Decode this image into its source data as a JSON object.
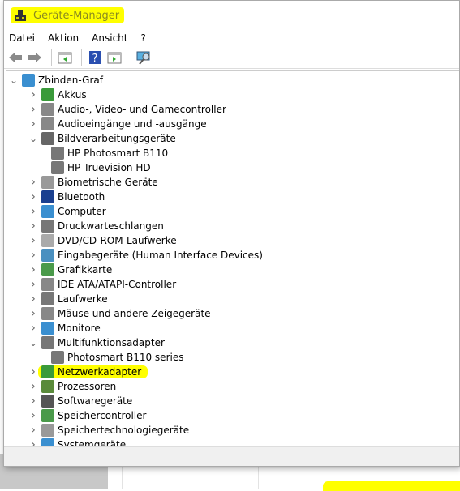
{
  "window": {
    "title": "Geräte-Manager"
  },
  "menu": [
    "Datei",
    "Aktion",
    "Ansicht",
    "?"
  ],
  "toolbar": [
    "back-icon",
    "forward-icon",
    "properties-icon",
    "help-icon",
    "update-icon",
    "scan-hardware-icon"
  ],
  "tree": [
    {
      "label": "Zbinden-Graf",
      "level": 0,
      "state": "expanded",
      "icon": "computer-icon"
    },
    {
      "label": "Akkus",
      "level": 1,
      "state": "collapsed",
      "icon": "battery-icon",
      "color": "#3a9a3a"
    },
    {
      "label": "Audio-, Video- und Gamecontroller",
      "level": 1,
      "state": "collapsed",
      "icon": "speaker-icon",
      "color": "#888888"
    },
    {
      "label": "Audioeingänge und -ausgänge",
      "level": 1,
      "state": "collapsed",
      "icon": "speaker-icon",
      "color": "#888888"
    },
    {
      "label": "Bildverarbeitungsgeräte",
      "level": 1,
      "state": "expanded",
      "icon": "camera-icon",
      "color": "#666666"
    },
    {
      "label": "HP Photosmart B110",
      "level": 2,
      "icon": "scanner-icon",
      "color": "#777777"
    },
    {
      "label": "HP Truevision HD",
      "level": 2,
      "icon": "camera-icon",
      "color": "#777777"
    },
    {
      "label": "Biometrische Geräte",
      "level": 1,
      "state": "collapsed",
      "icon": "fingerprint-icon",
      "color": "#999999"
    },
    {
      "label": "Bluetooth",
      "level": 1,
      "state": "collapsed",
      "icon": "bluetooth-icon",
      "color": "#1a3f8f"
    },
    {
      "label": "Computer",
      "level": 1,
      "state": "collapsed",
      "icon": "monitor-icon",
      "color": "#3a8fd0"
    },
    {
      "label": "Druckwarteschlangen",
      "level": 1,
      "state": "collapsed",
      "icon": "printer-icon",
      "color": "#777777"
    },
    {
      "label": "DVD/CD-ROM-Laufwerke",
      "level": 1,
      "state": "collapsed",
      "icon": "disc-icon",
      "color": "#aaaaaa"
    },
    {
      "label": "Eingabegeräte (Human Interface Devices)",
      "level": 1,
      "state": "collapsed",
      "icon": "hid-icon",
      "color": "#4a90c0"
    },
    {
      "label": "Grafikkarte",
      "level": 1,
      "state": "collapsed",
      "icon": "display-adapter-icon",
      "color": "#4a9a4a"
    },
    {
      "label": "IDE ATA/ATAPI-Controller",
      "level": 1,
      "state": "collapsed",
      "icon": "ide-controller-icon",
      "color": "#888888"
    },
    {
      "label": "Laufwerke",
      "level": 1,
      "state": "collapsed",
      "icon": "drive-icon",
      "color": "#777777"
    },
    {
      "label": "Mäuse und andere Zeigegeräte",
      "level": 1,
      "state": "collapsed",
      "icon": "mouse-icon",
      "color": "#888888"
    },
    {
      "label": "Monitore",
      "level": 1,
      "state": "collapsed",
      "icon": "monitor-icon",
      "color": "#3a8fd0"
    },
    {
      "label": "Multifunktionsadapter",
      "level": 1,
      "state": "expanded",
      "icon": "multifunction-icon",
      "color": "#777777"
    },
    {
      "label": "Photosmart B110 series",
      "level": 2,
      "icon": "printer-icon",
      "color": "#777777"
    },
    {
      "label": "Netzwerkadapter",
      "level": 1,
      "state": "collapsed",
      "icon": "network-adapter-icon",
      "color": "#3a9a3a",
      "highlighted": true
    },
    {
      "label": "Prozessoren",
      "level": 1,
      "state": "collapsed",
      "icon": "processor-icon",
      "color": "#5a8a3a"
    },
    {
      "label": "Softwaregeräte",
      "level": 1,
      "state": "collapsed",
      "icon": "software-device-icon",
      "color": "#555555"
    },
    {
      "label": "Speichercontroller",
      "level": 1,
      "state": "collapsed",
      "icon": "storage-controller-icon",
      "color": "#4a9a4a"
    },
    {
      "label": "Speichertechnologiegeräte",
      "level": 1,
      "state": "collapsed",
      "icon": "storage-tech-icon",
      "color": "#999999"
    },
    {
      "label": "Systemgeräte",
      "level": 1,
      "state": "collapsed",
      "icon": "system-device-icon",
      "color": "#3a8fd0"
    }
  ],
  "colors": {
    "highlight": "#ffff00"
  }
}
